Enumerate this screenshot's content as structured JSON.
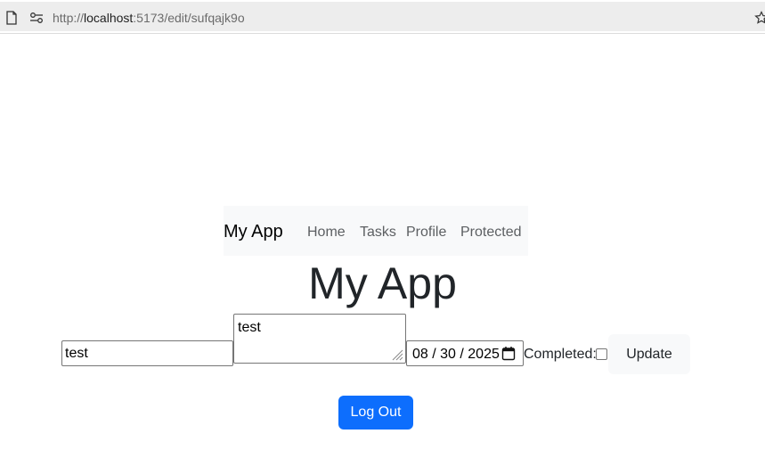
{
  "browser": {
    "url_scheme": "http://",
    "url_host": "localhost",
    "url_rest": ":5173/edit/sufqajk9o"
  },
  "navbar": {
    "brand": "My App",
    "links": [
      {
        "label": "Home"
      },
      {
        "label": "Tasks"
      },
      {
        "label": "Profile"
      },
      {
        "label": "Protected"
      }
    ]
  },
  "page": {
    "title": "My App"
  },
  "form": {
    "title_value": "test",
    "description_value": "test",
    "date_value": "08 / 30 / 2025",
    "completed_label": "Completed:",
    "completed_checked": false,
    "update_label": "Update"
  },
  "auth": {
    "logout_label": "Log Out"
  },
  "colors": {
    "primary": "#0d6efd",
    "navbar_bg": "#f8f9fa"
  }
}
